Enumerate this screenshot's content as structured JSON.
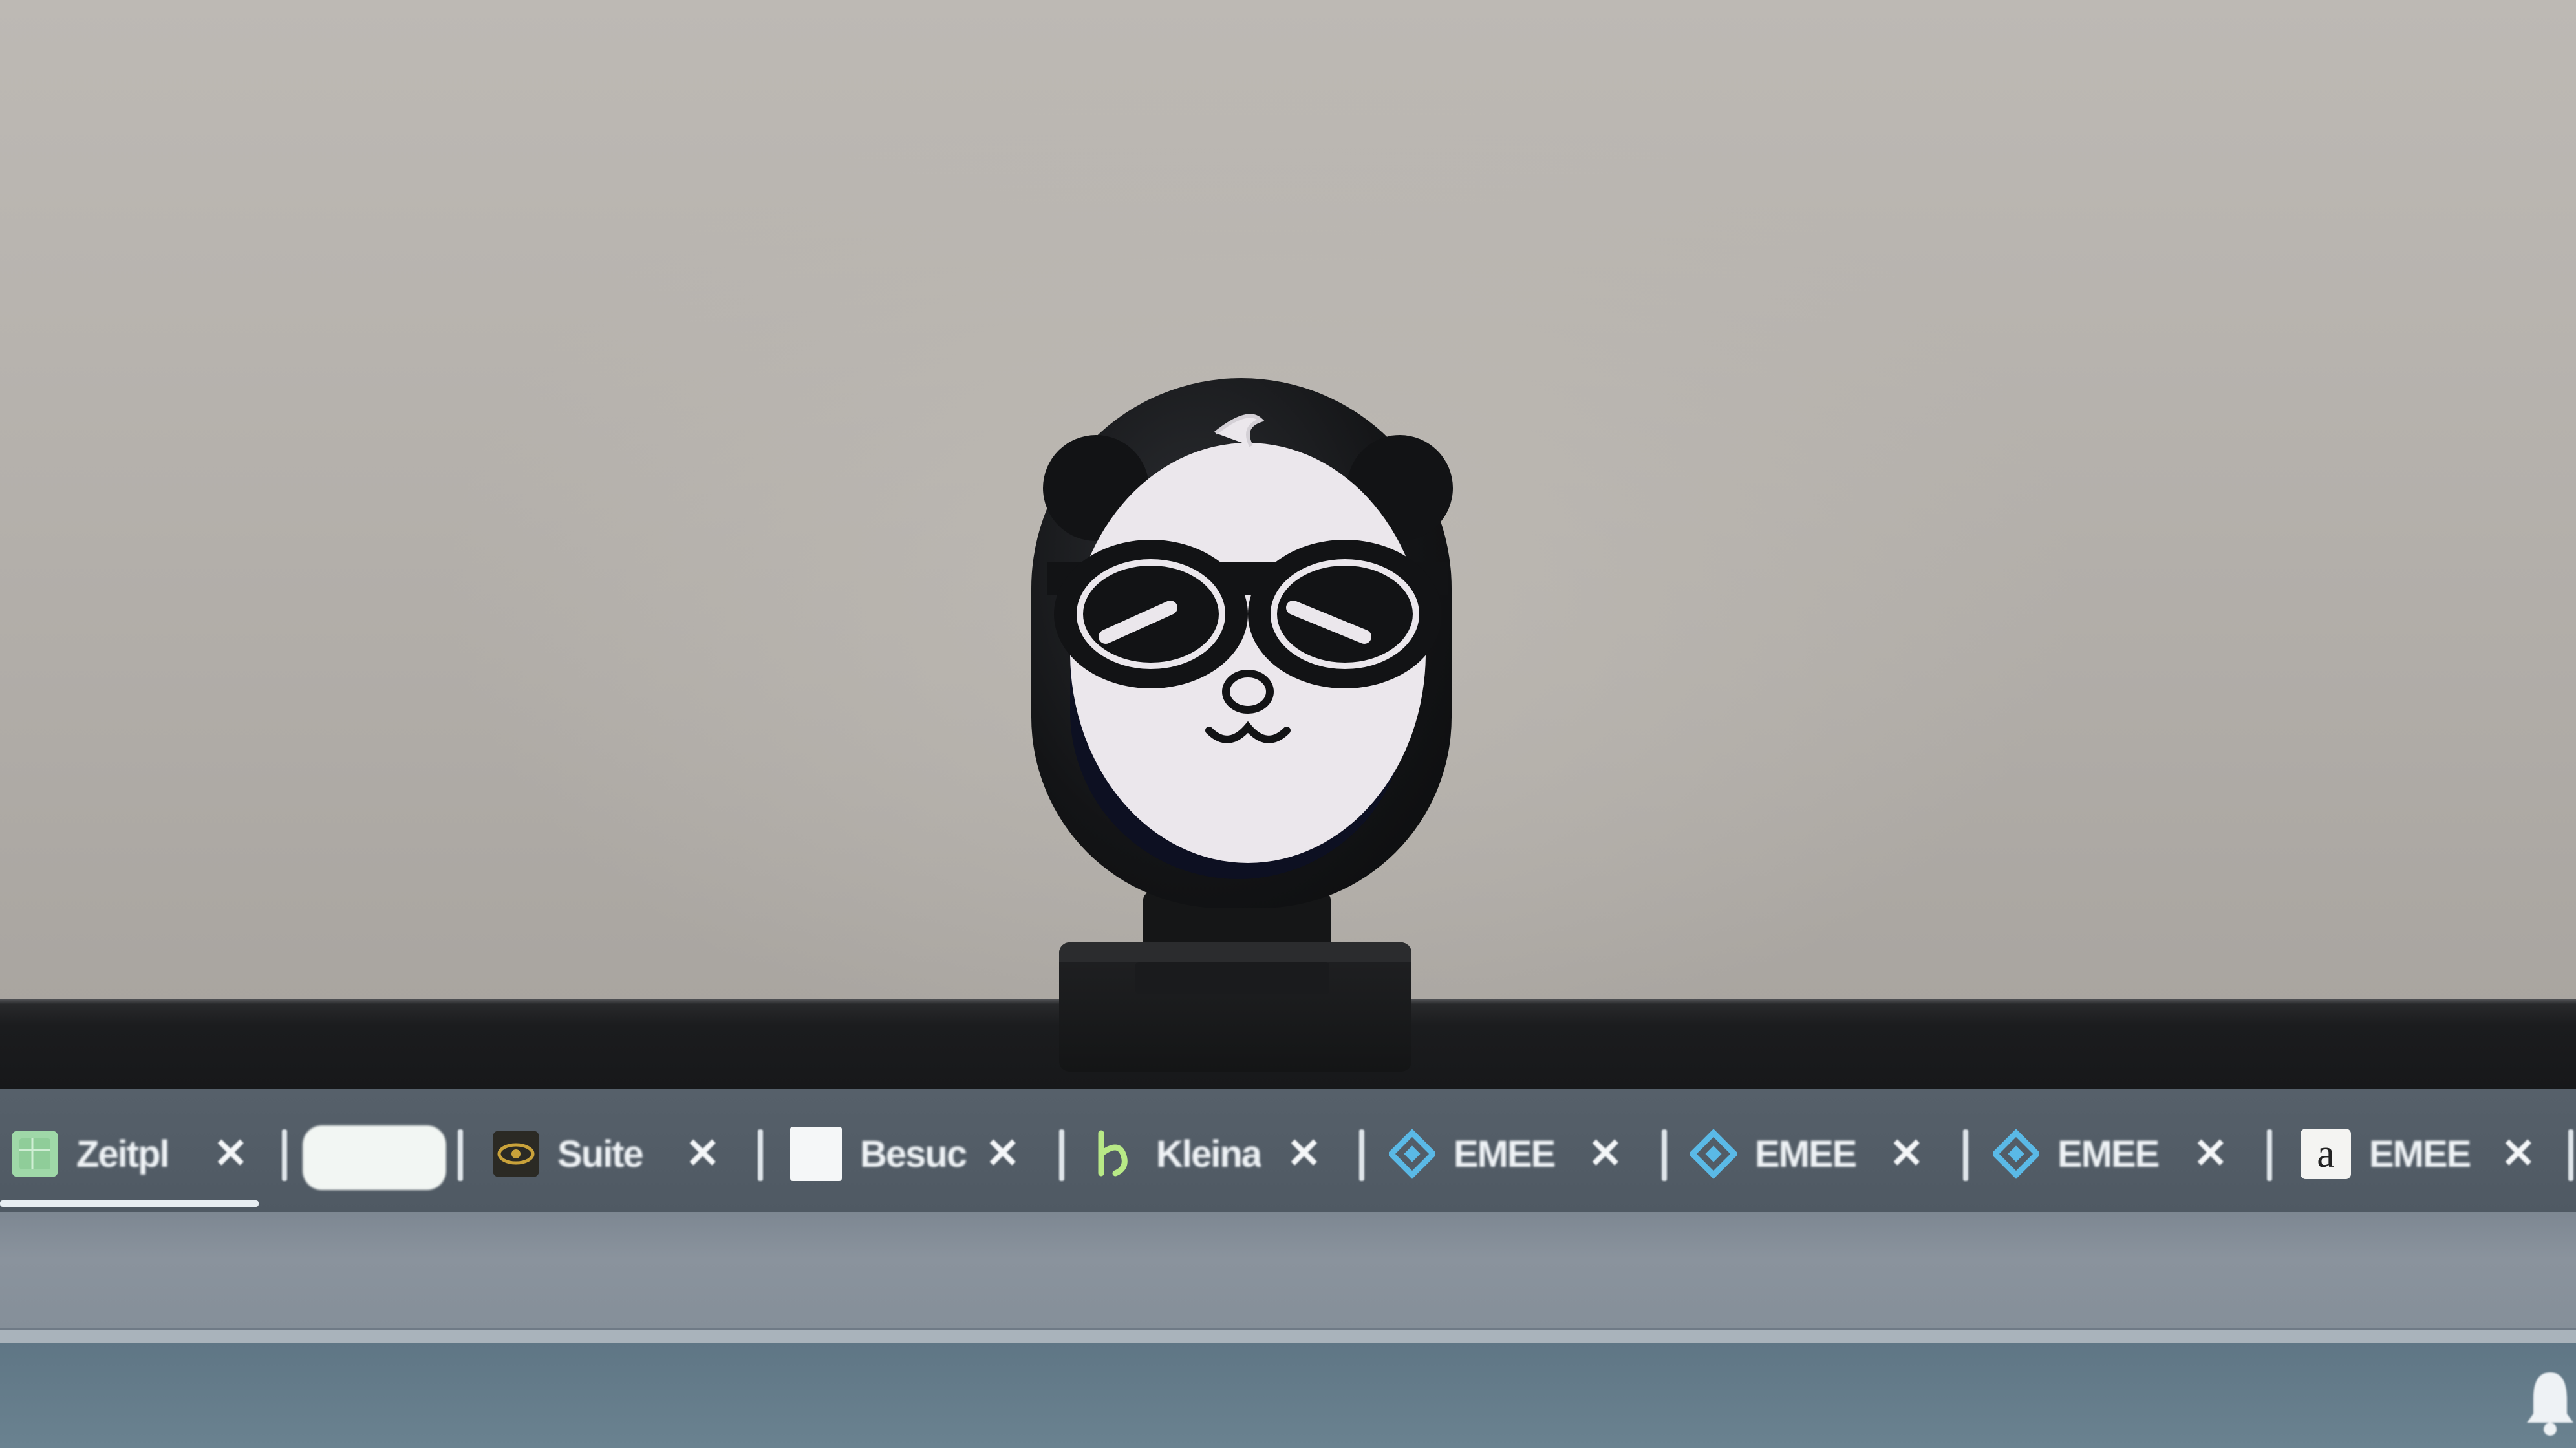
{
  "scene": {
    "wall_color": "#b4b1ac",
    "bezel_color": "#1b1c1e",
    "tabstrip_color": "#535d67"
  },
  "browser": {
    "tabs": [
      {
        "label": "Zeitpl",
        "icon": "spreadsheet-icon",
        "icon_color": "#9fd8a8",
        "close": "✕"
      },
      {
        "label": "",
        "icon": "active-tab-pill",
        "icon_color": "#f2f6f3",
        "close": ""
      },
      {
        "label": "Suite",
        "icon": "eye-logo-icon",
        "icon_color": "#c9a23a",
        "close": "✕"
      },
      {
        "label": "Besuc",
        "icon": "blank-page-icon",
        "icon_color": "#f5f7f8",
        "close": "✕"
      },
      {
        "label": "Kleina",
        "icon": "kleinanzeigen-icon",
        "icon_color": "#b8e986",
        "close": "✕"
      },
      {
        "label": "EMEE",
        "icon": "emeet-diamond-icon",
        "icon_color": "#5ab9e6",
        "close": "✕"
      },
      {
        "label": "EMEE",
        "icon": "emeet-diamond-icon",
        "icon_color": "#5ab9e6",
        "close": "✕"
      },
      {
        "label": "EMEE",
        "icon": "emeet-diamond-icon",
        "icon_color": "#5ab9e6",
        "close": "✕"
      },
      {
        "label": "EMEE",
        "icon": "amazon-a-icon",
        "icon_color": "#f4f4f2",
        "close": "✕"
      }
    ],
    "amazon_letter": "a",
    "notification_icon": "bell-icon"
  },
  "webcam": {
    "character": "panda-with-sunglasses",
    "body_color": "#141517",
    "face_color": "#ebe7ec",
    "lens_color": "#0d1022"
  }
}
